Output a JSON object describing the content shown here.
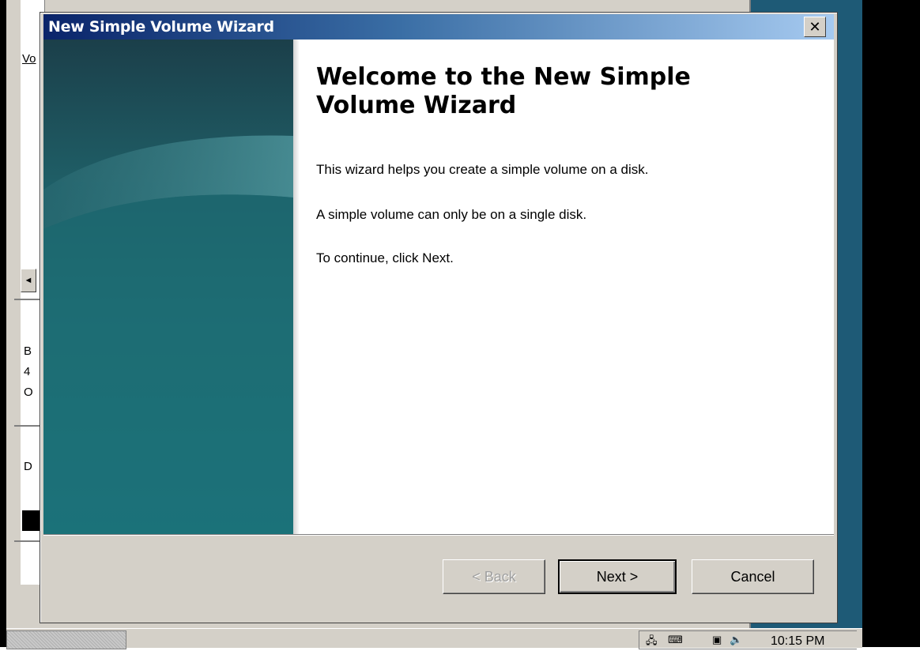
{
  "dialog": {
    "title": "New Simple Volume Wizard",
    "close_label": "✕",
    "heading": "Welcome to the New Simple Volume Wizard",
    "paragraphs": [
      "This wizard helps you create a simple volume on a disk.",
      "A simple volume can only be on a single disk.",
      "To continue, click Next."
    ],
    "buttons": {
      "back": "< Back",
      "next": "Next >",
      "cancel": "Cancel"
    }
  },
  "background_window": {
    "fragments": [
      "Vo",
      "B",
      "4",
      "O",
      "D"
    ],
    "scroll_arrow": "◄"
  },
  "taskbar": {
    "clock": "10:15 PM"
  },
  "colors": {
    "titlebar_start": "#0a246a",
    "titlebar_end": "#a6caf0",
    "side_panel": "#1e6e74",
    "desktop": "#1e5a76"
  }
}
